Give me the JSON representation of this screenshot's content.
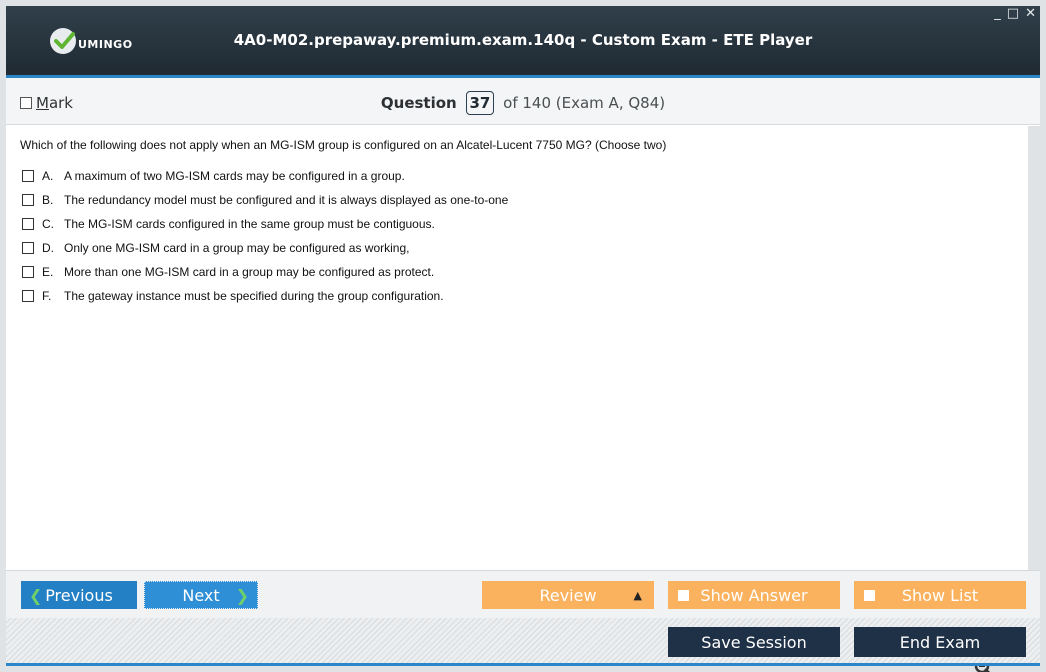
{
  "window": {
    "logo_text": "UMINGO",
    "title": "4A0-M02.prepaway.premium.exam.140q - Custom Exam - ETE Player",
    "controls": [
      "_",
      "□",
      "✕"
    ]
  },
  "header": {
    "mark_label_underlined": "M",
    "mark_label_rest": "ark",
    "question_label": "Question",
    "question_number": "37",
    "question_suffix": "of 140 (Exam A, Q84)"
  },
  "question": {
    "text": "Which of the following does not apply when an MG-ISM group is configured on an Alcatel-Lucent 7750 MG? (Choose two)",
    "options": [
      {
        "letter": "A.",
        "text": "A maximum of two MG-ISM cards may be configured in a group."
      },
      {
        "letter": "B.",
        "text": "The redundancy model must be configured and it is always displayed as one-to-one"
      },
      {
        "letter": "C.",
        "text": "The MG-ISM cards configured in the same group must be contiguous."
      },
      {
        "letter": "D.",
        "text": "Only one MG-ISM card in a group may be configured as working,"
      },
      {
        "letter": "E.",
        "text": "More than one MG-ISM card in a group may be configured as protect."
      },
      {
        "letter": "F.",
        "text": "The gateway instance must be specified during the group configuration."
      }
    ]
  },
  "nav": {
    "previous_label": "Previous",
    "next_label": "Next",
    "review_label": "Review",
    "show_answer_label": "Show Answer",
    "show_list_label": "Show List",
    "save_session_label": "Save Session",
    "end_exam_label": "End Exam"
  },
  "colors": {
    "accent_blue": "#2a86c9",
    "button_orange": "#fbb25f",
    "button_dark": "#1f3147",
    "titlebar": "#25323c"
  },
  "icons": [
    "logo-check-icon",
    "search-icon",
    "zoom-in-icon",
    "zoom-out-icon",
    "chevron-left-icon",
    "chevron-right-icon",
    "caret-up-icon"
  ]
}
